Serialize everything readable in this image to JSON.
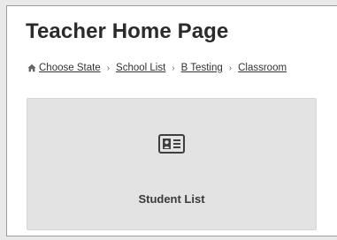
{
  "page": {
    "title": "Teacher Home Page"
  },
  "breadcrumb": {
    "items": [
      {
        "label": "Choose State"
      },
      {
        "label": "School List"
      },
      {
        "label": "B Testing"
      },
      {
        "label": "Classroom"
      }
    ],
    "separator": "›",
    "icon": "home-icon"
  },
  "tiles": [
    {
      "label": "Student List",
      "icon": "id-card-icon"
    }
  ],
  "colors": {
    "background": "#e9e9e9",
    "panel": "#ffffff",
    "tile": "#e3e3e3",
    "text": "#2b2b2b"
  }
}
